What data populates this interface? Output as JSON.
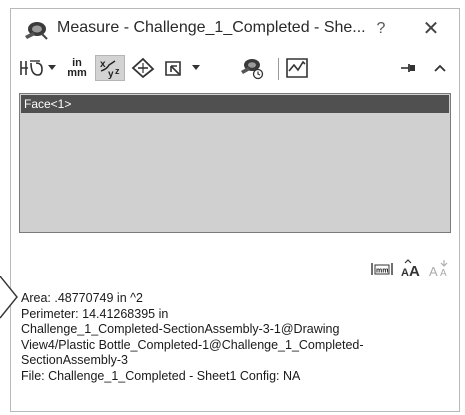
{
  "window": {
    "title": "Measure - Challenge_1_Completed - She...",
    "help_label": "?",
    "close_label": "✕"
  },
  "toolbar": {
    "units_label_top": "in",
    "units_label_bottom": "mm",
    "xyz_label": "x",
    "icons": [
      "arc-circle-measure-icon",
      "units-precision-icon",
      "xyz-measure-icon",
      "point-to-point-icon",
      "projection-icon",
      "sensor-icon",
      "history-icon",
      "pin-icon",
      "collapse-icon"
    ]
  },
  "selection_list": {
    "items": [
      "Face<1>"
    ]
  },
  "results": {
    "lines": [
      "Area: .48770749 in ^2",
      "Perimeter: 14.41268395 in",
      "Challenge_1_Completed-SectionAssembly-3-1@Drawing",
      "View4/Plastic Bottle_Completed-1@Challenge_1_Completed-",
      "SectionAssembly-3",
      "File: Challenge_1_Completed - Sheet1 Config: NA"
    ],
    "tools": [
      "dual-dimension-icon",
      "increase-font-icon",
      "decrease-font-icon"
    ]
  },
  "colors": {
    "list_background": "#d0d0d0",
    "selected_item": "#505050",
    "toolbar_selected": "#d3d3d3"
  }
}
